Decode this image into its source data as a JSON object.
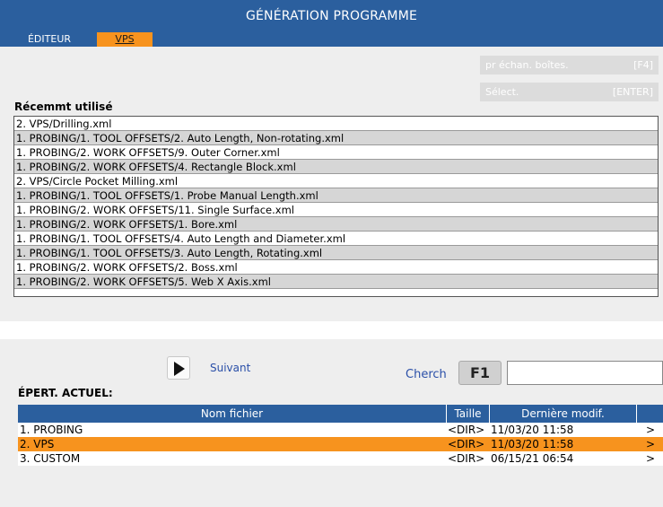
{
  "window": {
    "title": "GÉNÉRATION PROGRAMME"
  },
  "tabs": [
    {
      "label": "ÉDITEUR",
      "active": false
    },
    {
      "label": "VPS",
      "active": true
    }
  ],
  "actions": {
    "sample_boxes": {
      "label": "pr échan. boîtes.",
      "key": "[F4]"
    },
    "select": {
      "label": "Sélect.",
      "key": "[ENTER]"
    }
  },
  "recent": {
    "label": "Récemmt utilisé",
    "items": [
      "2. VPS/Drilling.xml",
      "1. PROBING/1. TOOL OFFSETS/2. Auto Length, Non-rotating.xml",
      "1. PROBING/2. WORK OFFSETS/9. Outer Corner.xml",
      "1. PROBING/2. WORK OFFSETS/4. Rectangle Block.xml",
      "2. VPS/Circle Pocket Milling.xml",
      "1. PROBING/1. TOOL OFFSETS/1. Probe Manual Length.xml",
      "1. PROBING/2. WORK OFFSETS/11. Single Surface.xml",
      "1. PROBING/2. WORK OFFSETS/1. Bore.xml",
      "1. PROBING/1. TOOL OFFSETS/4. Auto Length and Diameter.xml",
      "1. PROBING/1. TOOL OFFSETS/3. Auto Length, Rotating.xml",
      "1. PROBING/2. WORK OFFSETS/2. Boss.xml",
      "1. PROBING/2. WORK OFFSETS/5. Web X Axis.xml"
    ]
  },
  "nav": {
    "next_label": "Suivant"
  },
  "search": {
    "label": "Cherch",
    "key": "F1",
    "value": ""
  },
  "directory": {
    "label": "ÉPERT. ACTUEL:",
    "columns": [
      "Nom fichier",
      "Taille",
      "Dernière modif.",
      ""
    ],
    "rows": [
      {
        "name": "1. PROBING",
        "size": "<DIR>",
        "modified": "11/03/20 11:58",
        "arrow": ">",
        "selected": false
      },
      {
        "name": "2. VPS",
        "size": "<DIR>",
        "modified": "11/03/20 11:58",
        "arrow": ">",
        "selected": true
      },
      {
        "name": "3. CUSTOM",
        "size": "<DIR>",
        "modified": "06/15/21 06:54",
        "arrow": ">",
        "selected": false
      }
    ]
  },
  "colors": {
    "header_blue": "#2b5f9e",
    "accent_orange": "#f7931e",
    "link_blue": "#2a4fa8"
  }
}
